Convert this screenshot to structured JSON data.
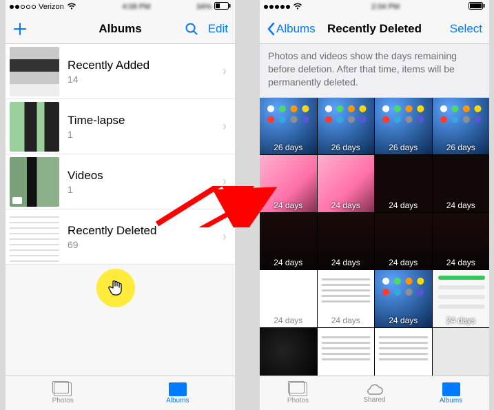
{
  "left": {
    "status": {
      "carrier": "Verizon",
      "time": "4:08 PM",
      "battery": "34%"
    },
    "nav": {
      "title": "Albums",
      "edit": "Edit"
    },
    "albums": [
      {
        "title": "Recently Added",
        "count": "14"
      },
      {
        "title": "Time-lapse",
        "count": "1"
      },
      {
        "title": "Videos",
        "count": "1"
      },
      {
        "title": "Recently Deleted",
        "count": "69"
      }
    ],
    "tabs": {
      "photos": "Photos",
      "albums": "Albums"
    }
  },
  "right": {
    "status": {
      "time": "2:04 PM"
    },
    "nav": {
      "back": "Albums",
      "title": "Recently Deleted",
      "select": "Select"
    },
    "banner": "Photos and videos show the days remaining before deletion. After that time, items will be permanently deleted.",
    "grid_days": [
      "26 days",
      "26 days",
      "26 days",
      "26 days",
      "24 days",
      "24 days",
      "24 days",
      "24 days",
      "24 days",
      "24 days",
      "24 days",
      "24 days",
      "24 days",
      "24 days",
      "24 days",
      "24 days"
    ],
    "tabs": {
      "photos": "Photos",
      "shared": "Shared",
      "albums": "Albums"
    }
  }
}
